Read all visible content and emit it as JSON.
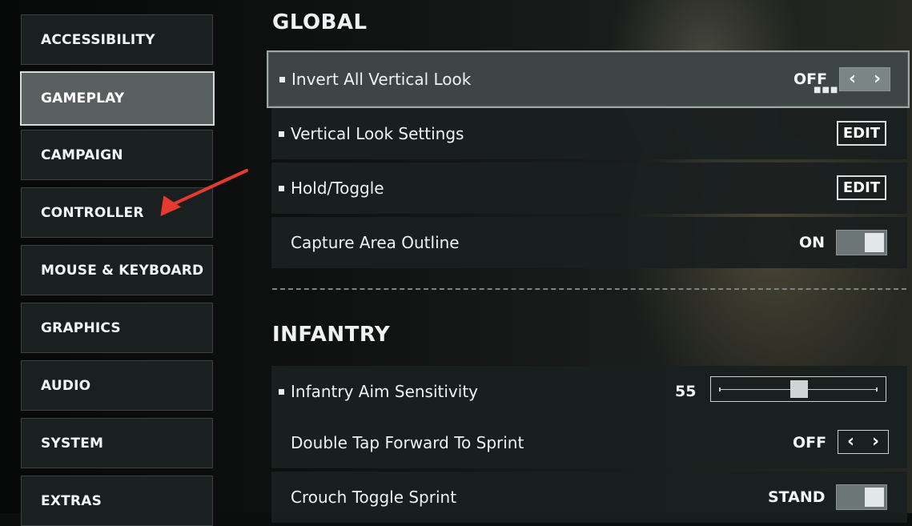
{
  "sidebar": {
    "items": [
      {
        "label": "ACCESSIBILITY"
      },
      {
        "label": "GAMEPLAY",
        "active": true
      },
      {
        "label": "CAMPAIGN"
      },
      {
        "label": "CONTROLLER"
      },
      {
        "label": "MOUSE & KEYBOARD"
      },
      {
        "label": "GRAPHICS"
      },
      {
        "label": "AUDIO"
      },
      {
        "label": "SYSTEM"
      },
      {
        "label": "EXTRAS"
      }
    ]
  },
  "global": {
    "title": "GLOBAL",
    "rows": [
      {
        "label": "Invert All Vertical Look",
        "value": "OFF",
        "control": "arrows",
        "bullet": true
      },
      {
        "label": "Vertical Look Settings",
        "button": "EDIT",
        "control": "edit",
        "bullet": true
      },
      {
        "label": "Hold/Toggle",
        "button": "EDIT",
        "control": "edit",
        "bullet": true
      },
      {
        "label": "Capture Area Outline",
        "value": "ON",
        "control": "toggle",
        "bullet": false
      }
    ]
  },
  "infantry": {
    "title": "INFANTRY",
    "rows": [
      {
        "label": "Infantry Aim Sensitivity",
        "value": "55",
        "control": "slider",
        "slider_fraction": 0.5,
        "bullet": true
      },
      {
        "label": "Double Tap Forward To Sprint",
        "value": "OFF",
        "control": "arrows",
        "bullet": false
      },
      {
        "label": "Crouch Toggle Sprint",
        "value": "STAND",
        "control": "toggle",
        "bullet": false
      }
    ]
  },
  "icons": {
    "left_arrow": "chevron-left-icon",
    "right_arrow": "chevron-right-icon",
    "annotation": "red-arrow-annotation-icon"
  },
  "colors": {
    "annotation_arrow": "#e53b2e",
    "active_tab_bg": "#59605f",
    "row_bg": "#1a1f1f"
  }
}
